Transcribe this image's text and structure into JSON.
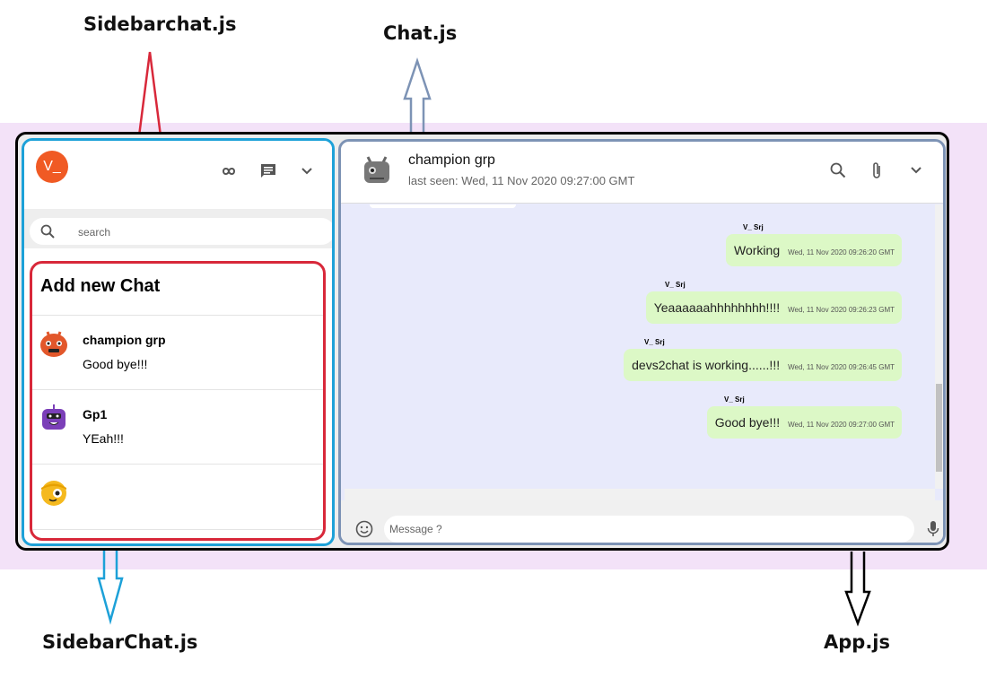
{
  "annotations": {
    "sidebarchat_top": "Sidebarchat.js",
    "chat_top": "Chat.js",
    "sidebarchat_bottom": "SidebarChat.js",
    "app_bottom": "App.js"
  },
  "sidebar": {
    "avatar_text": "V_",
    "search_placeholder": "search",
    "add_new_chat": "Add new Chat",
    "chats": [
      {
        "name": "champion grp",
        "last_message": "Good bye!!!"
      },
      {
        "name": "Gp1",
        "last_message": "YEah!!!"
      }
    ]
  },
  "chat": {
    "title": "champion grp",
    "last_seen": "last seen: Wed, 11 Nov 2020 09:27:00 GMT",
    "messages": [
      {
        "sender": "V_ Srj",
        "text": "Working",
        "timestamp": "Wed, 11 Nov 2020 09:26:20 GMT"
      },
      {
        "sender": "V_ Srj",
        "text": "Yeaaaaaahhhhhhhh!!!!",
        "timestamp": "Wed, 11 Nov 2020 09:26:23 GMT"
      },
      {
        "sender": "V_ Srj",
        "text": "devs2chat is working......!!!",
        "timestamp": "Wed, 11 Nov 2020 09:26:45 GMT"
      },
      {
        "sender": "V_ Srj",
        "text": "Good bye!!!",
        "timestamp": "Wed, 11 Nov 2020 09:27:00 GMT"
      }
    ],
    "input_placeholder": "Message ?"
  },
  "colors": {
    "sidebar_border": "#1da1d8",
    "chatlist_border": "#d8283a",
    "chat_border": "#7d93b5",
    "app_border": "#000000",
    "bubble": "#dcf8c6",
    "avatar": "#f05a24",
    "chat_background": "#e8eafb"
  },
  "icons": [
    "infinity-icon",
    "chat-icon",
    "chevron-down-icon",
    "search-icon",
    "attach-icon",
    "emoji-icon",
    "mic-icon"
  ]
}
